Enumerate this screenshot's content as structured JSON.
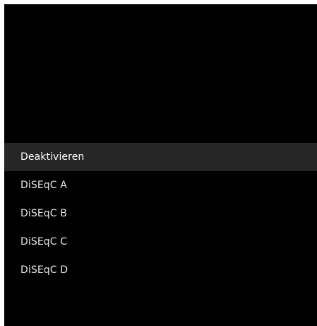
{
  "menu": {
    "selected_index": 0,
    "items": [
      {
        "label": "Deaktivieren"
      },
      {
        "label": "DiSEqC A"
      },
      {
        "label": "DiSEqC B"
      },
      {
        "label": "DiSEqC C"
      },
      {
        "label": "DiSEqC D"
      }
    ]
  },
  "colors": {
    "background": "#000000",
    "selected_row": "#262626",
    "text": "#e6e6e6"
  }
}
